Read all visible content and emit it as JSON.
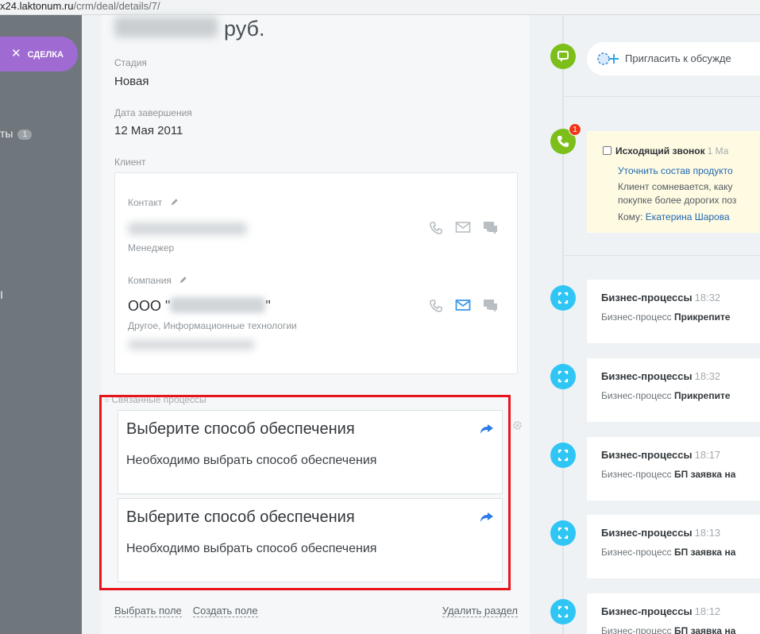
{
  "url": {
    "host": "x24.laktonum.ru",
    "path": "/crm/deal/details/7/"
  },
  "sidebar": {
    "deal_button": "СДЕЛКА",
    "item1_label": "ты",
    "item1_count": "1",
    "item2_label": "І"
  },
  "deal": {
    "price_suffix": "руб.",
    "stage_label": "Стадия",
    "stage_value": "Новая",
    "close_date_label": "Дата завершения",
    "close_date_value": "12 Мая 2011",
    "client_label": "Клиент"
  },
  "client": {
    "contact_label": "Контакт",
    "contact_role": "Менеджер",
    "company_label": "Компания",
    "company_prefix": "ООО \"",
    "company_suffix": "\"",
    "company_industry": "Другое, Информационные технологии"
  },
  "related": {
    "label": "Связанные процессы",
    "processes": [
      {
        "title": "Выберите способ обеспечения",
        "description": "Необходимо выбрать способ обеспечения"
      },
      {
        "title": "Выберите способ обеспечения",
        "description": "Необходимо выбрать способ обеспечения"
      }
    ]
  },
  "footer": {
    "select_field": "Выбрать поле",
    "create_field": "Создать поле",
    "delete_section": "Удалить раздел"
  },
  "timeline": {
    "invite_text": "Пригласить к обсужде",
    "call": {
      "badge": "1",
      "title": "Исходящий звонок",
      "time": "1 Ма",
      "link": "Уточнить состав продукто",
      "line1": "Клиент сомневается, каку",
      "line2": "покупке более дорогих поз",
      "to_label": "Кому:",
      "to_name": "Екатерина Шарова"
    },
    "entries": [
      {
        "title": "Бизнес-процессы",
        "time": "18:32",
        "prefix": "Бизнес-процесс",
        "bold": "Прикрепите"
      },
      {
        "title": "Бизнес-процессы",
        "time": "18:32",
        "prefix": "Бизнес-процесс",
        "bold": "Прикрепите"
      },
      {
        "title": "Бизнес-процессы",
        "time": "18:17",
        "prefix": "Бизнес-процесс",
        "bold": "БП заявка на"
      },
      {
        "title": "Бизнес-процессы",
        "time": "18:13",
        "prefix": "Бизнес-процесс",
        "bold": "БП заявка на"
      },
      {
        "title": "Бизнес-процессы",
        "time": "18:12",
        "prefix": "Бизнес-процесс",
        "bold": "БП заявка на"
      }
    ]
  },
  "colors": {
    "accent_purple": "#9f6bd2",
    "timeline_green": "#7dbf1a",
    "timeline_blue": "#2fc6f6",
    "highlight_red": "#e8141c",
    "link_blue": "#2067b0"
  }
}
